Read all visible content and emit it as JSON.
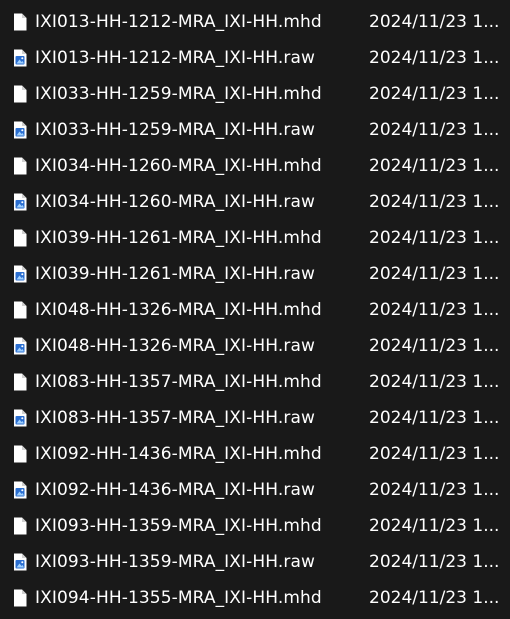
{
  "files": [
    {
      "name": "IXI013-HH-1212-MRA_IXI-HH.mhd",
      "date": "2024/11/23 1...",
      "icon": "document-icon"
    },
    {
      "name": "IXI013-HH-1212-MRA_IXI-HH.raw",
      "date": "2024/11/23 1...",
      "icon": "image-file-icon"
    },
    {
      "name": "IXI033-HH-1259-MRA_IXI-HH.mhd",
      "date": "2024/11/23 1...",
      "icon": "document-icon"
    },
    {
      "name": "IXI033-HH-1259-MRA_IXI-HH.raw",
      "date": "2024/11/23 1...",
      "icon": "image-file-icon"
    },
    {
      "name": "IXI034-HH-1260-MRA_IXI-HH.mhd",
      "date": "2024/11/23 1...",
      "icon": "document-icon"
    },
    {
      "name": "IXI034-HH-1260-MRA_IXI-HH.raw",
      "date": "2024/11/23 1...",
      "icon": "image-file-icon"
    },
    {
      "name": "IXI039-HH-1261-MRA_IXI-HH.mhd",
      "date": "2024/11/23 1...",
      "icon": "document-icon"
    },
    {
      "name": "IXI039-HH-1261-MRA_IXI-HH.raw",
      "date": "2024/11/23 1...",
      "icon": "image-file-icon"
    },
    {
      "name": "IXI048-HH-1326-MRA_IXI-HH.mhd",
      "date": "2024/11/23 1...",
      "icon": "document-icon"
    },
    {
      "name": "IXI048-HH-1326-MRA_IXI-HH.raw",
      "date": "2024/11/23 1...",
      "icon": "image-file-icon"
    },
    {
      "name": "IXI083-HH-1357-MRA_IXI-HH.mhd",
      "date": "2024/11/23 1...",
      "icon": "document-icon"
    },
    {
      "name": "IXI083-HH-1357-MRA_IXI-HH.raw",
      "date": "2024/11/23 1...",
      "icon": "image-file-icon"
    },
    {
      "name": "IXI092-HH-1436-MRA_IXI-HH.mhd",
      "date": "2024/11/23 1...",
      "icon": "document-icon"
    },
    {
      "name": "IXI092-HH-1436-MRA_IXI-HH.raw",
      "date": "2024/11/23 1...",
      "icon": "image-file-icon"
    },
    {
      "name": "IXI093-HH-1359-MRA_IXI-HH.mhd",
      "date": "2024/11/23 1...",
      "icon": "document-icon"
    },
    {
      "name": "IXI093-HH-1359-MRA_IXI-HH.raw",
      "date": "2024/11/23 1...",
      "icon": "image-file-icon"
    },
    {
      "name": "IXI094-HH-1355-MRA_IXI-HH.mhd",
      "date": "2024/11/23 1...",
      "icon": "document-icon"
    }
  ],
  "colors": {
    "background": "#191919",
    "text": "#ffffff",
    "icon_page": "#ffffff",
    "icon_image_accent": "#2b6fd1"
  }
}
